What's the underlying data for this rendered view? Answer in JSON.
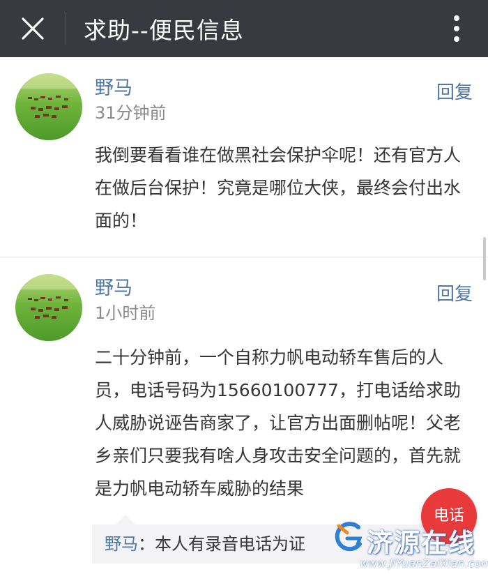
{
  "header": {
    "title": "求助--便民信息",
    "close_icon": "close-icon",
    "more_icon": "more-vertical-icon",
    "background": "#393a3f"
  },
  "comments": [
    {
      "author": "野马",
      "time": "31分钟前",
      "reply_label": "回复",
      "text": "我倒要看看谁在做黑社会保护伞呢！还有官方人在做后台保护！究竟是哪位大侠，最终会付出水面的！"
    },
    {
      "author": "野马",
      "time": "1小时前",
      "reply_label": "回复",
      "text": "二十分钟前，一个自称力帆电动轿车售后的人员，电话号码为15660100777，打电话给求助人威胁说诬告商家了，让官方出面删帖呢！父老乡亲们只要我有啥人身攻击安全问题的，首先就是力帆电动轿车威胁的结果",
      "reply": {
        "author": "野马",
        "separator": "：",
        "text": "本人有录音电话为证"
      }
    }
  ],
  "call_button": {
    "label": "电话",
    "color": "#e83a3a"
  },
  "watermark": {
    "name": "济源在线",
    "url": "www.JiYuanZaiXian.com"
  },
  "colors": {
    "link": "#5077a5",
    "text": "#353535",
    "muted": "#8a8a8a"
  }
}
